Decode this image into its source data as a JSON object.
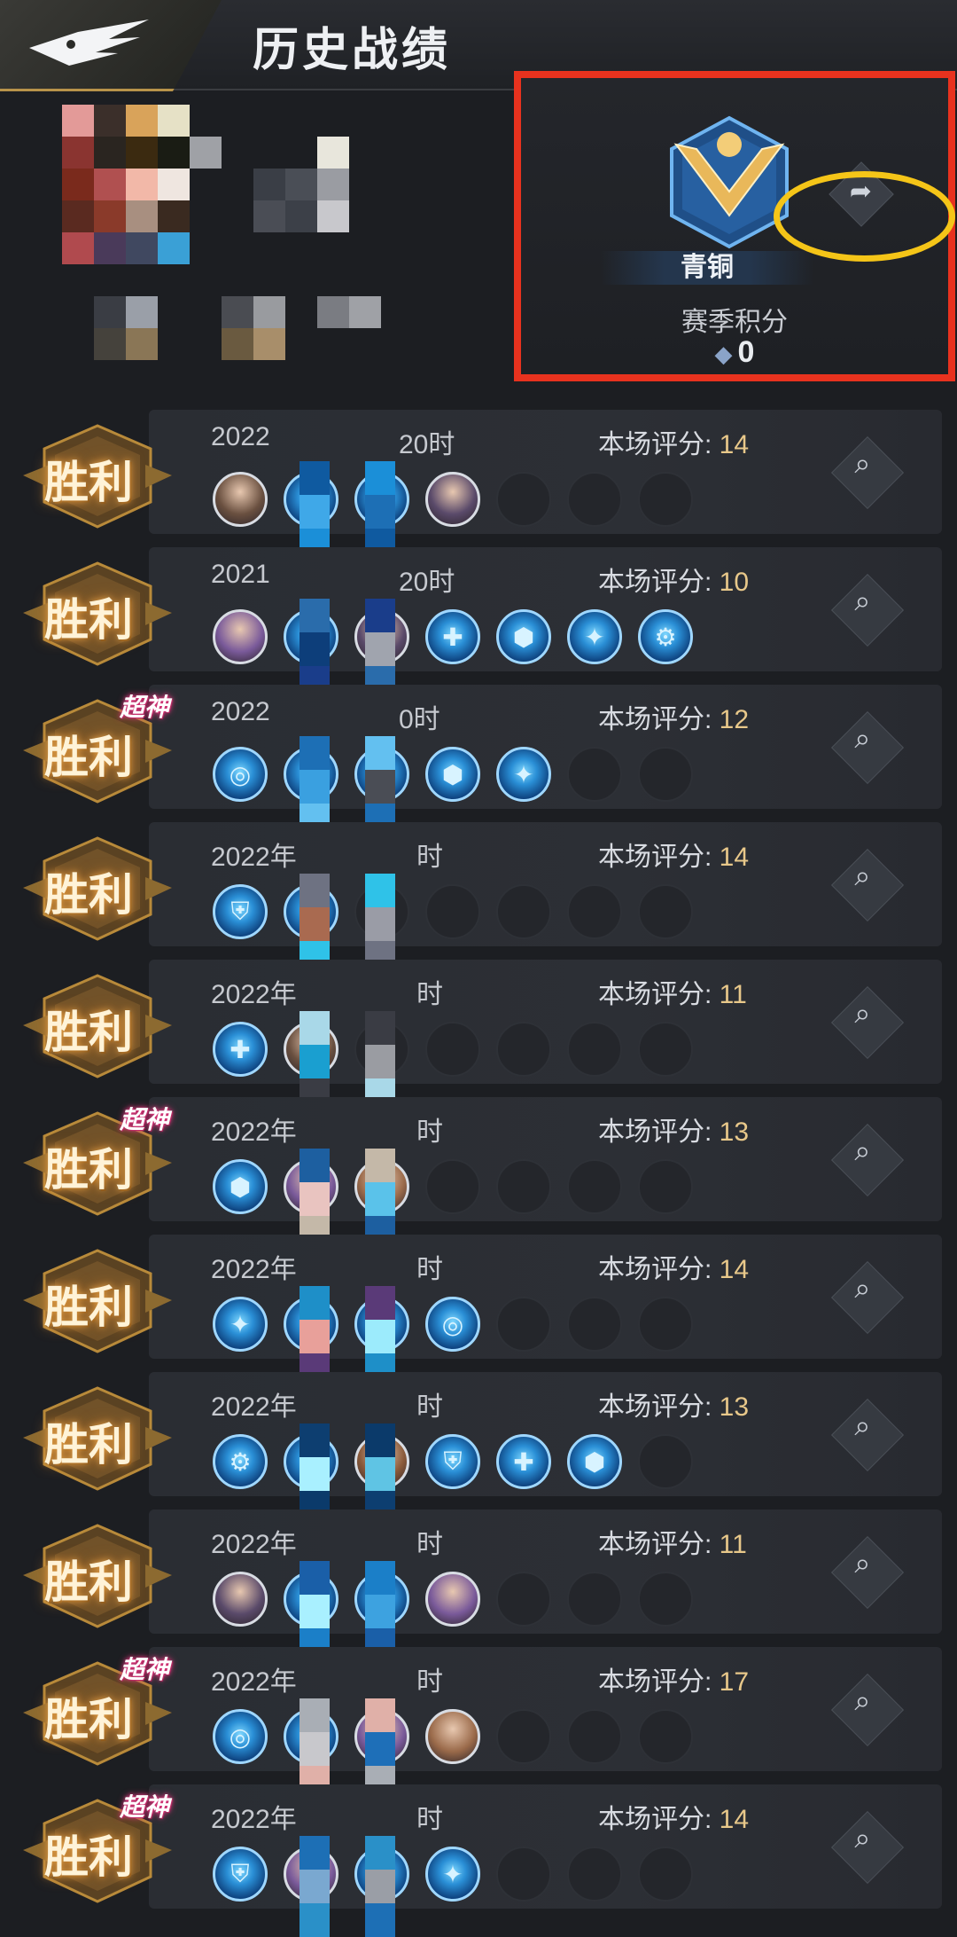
{
  "header": {
    "title": "历史战绩",
    "logo_icon": "eagle-wing-icon"
  },
  "rank": {
    "name": "青铜",
    "season_label": "赛季积分",
    "season_score": "0",
    "share_icon": "share-arrow-icon",
    "highlight_color": "#f5c518",
    "frame_color": "#e8321e"
  },
  "matches": [
    {
      "result": "胜利",
      "mvp": "",
      "date": "2022",
      "date_tail": "20时",
      "score_label": "本场评分:",
      "score": "14",
      "slots": [
        "hero",
        "equip",
        "equip",
        "hero",
        "empty",
        "empty",
        "empty"
      ]
    },
    {
      "result": "胜利",
      "mvp": "",
      "date": "2021",
      "date_tail": "20时",
      "score_label": "本场评分:",
      "score": "10",
      "slots": [
        "hero",
        "equip",
        "hero",
        "equip",
        "equip",
        "equip",
        "equip"
      ]
    },
    {
      "result": "胜利",
      "mvp": "超神",
      "date": "2022",
      "date_tail": "0时",
      "score_label": "本场评分:",
      "score": "12",
      "slots": [
        "equip",
        "equip",
        "equip",
        "equip",
        "equip",
        "empty",
        "empty"
      ]
    },
    {
      "result": "胜利",
      "mvp": "",
      "date": "2022年",
      "date_tail": "时",
      "score_label": "本场评分:",
      "score": "14",
      "slots": [
        "equip",
        "equip",
        "empty",
        "empty",
        "empty",
        "empty",
        "empty"
      ]
    },
    {
      "result": "胜利",
      "mvp": "",
      "date": "2022年",
      "date_tail": "时",
      "score_label": "本场评分:",
      "score": "11",
      "slots": [
        "equip",
        "hero",
        "empty",
        "empty",
        "empty",
        "empty",
        "empty"
      ]
    },
    {
      "result": "胜利",
      "mvp": "超神",
      "date": "2022年",
      "date_tail": "时",
      "score_label": "本场评分:",
      "score": "13",
      "slots": [
        "equip",
        "hero",
        "hero",
        "empty",
        "empty",
        "empty",
        "empty"
      ]
    },
    {
      "result": "胜利",
      "mvp": "",
      "date": "2022年",
      "date_tail": "时",
      "score_label": "本场评分:",
      "score": "14",
      "slots": [
        "equip",
        "equip",
        "equip",
        "equip",
        "empty",
        "empty",
        "empty"
      ]
    },
    {
      "result": "胜利",
      "mvp": "",
      "date": "2022年",
      "date_tail": "时",
      "score_label": "本场评分:",
      "score": "13",
      "slots": [
        "equip",
        "equip",
        "hero",
        "equip",
        "equip",
        "equip",
        "empty"
      ]
    },
    {
      "result": "胜利",
      "mvp": "",
      "date": "2022年",
      "date_tail": "时",
      "score_label": "本场评分:",
      "score": "11",
      "slots": [
        "hero",
        "equip",
        "equip",
        "hero",
        "empty",
        "empty",
        "empty"
      ]
    },
    {
      "result": "胜利",
      "mvp": "超神",
      "date": "2022年",
      "date_tail": "时",
      "score_label": "本场评分:",
      "score": "17",
      "slots": [
        "equip",
        "equip",
        "hero",
        "hero",
        "empty",
        "empty",
        "empty"
      ]
    },
    {
      "result": "胜利",
      "mvp": "超神",
      "date": "2022年",
      "date_tail": "时",
      "score_label": "本场评分:",
      "score": "14",
      "slots": [
        "equip",
        "hero",
        "equip",
        "equip",
        "empty",
        "empty",
        "empty"
      ]
    }
  ],
  "icons": {
    "view_detail": "magnifier-icon",
    "win_badge": "winged-shield-icon"
  }
}
